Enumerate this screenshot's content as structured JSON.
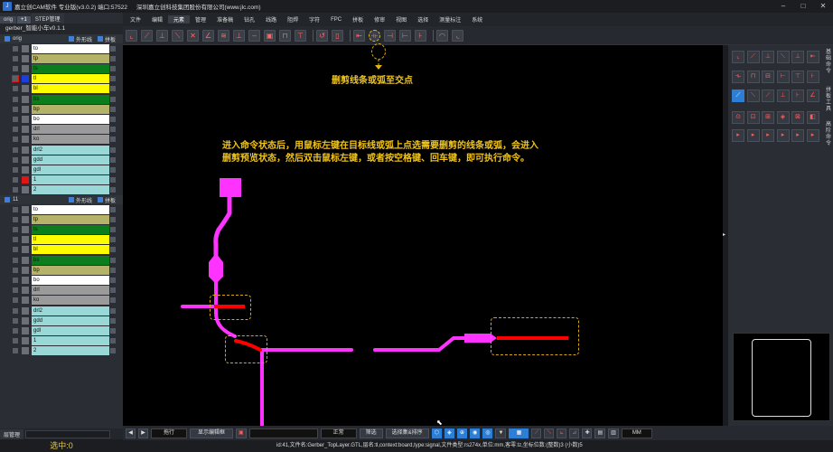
{
  "title": {
    "app": "嘉立创CAM软件 专业版(v3.0.2) 端口:57522",
    "company": "深圳嘉立创科技集团股份有限公司(www.jlc.com)"
  },
  "menu": [
    "文件",
    "编辑",
    "元素",
    "管理",
    "准备稿",
    "钻孔",
    "线路",
    "阻焊",
    "字符",
    "FPC",
    "拼板",
    "修审",
    "视图",
    "选择",
    "测量标注",
    "系统"
  ],
  "left": {
    "tabs": [
      "orig",
      "+1",
      "STEP管理"
    ],
    "root": "gerber_智能小车v0.1.1",
    "group1": {
      "name": "orig",
      "opt1": "外形线",
      "opt2": "拼板"
    },
    "group2": {
      "name": "11",
      "opt1": "外形线",
      "opt2": "拼板"
    },
    "layers1": [
      {
        "name": "to",
        "color": "#ffffff",
        "sq": "#6a6f78"
      },
      {
        "name": "tp",
        "color": "#b5b26a",
        "sq": "#6a6f78"
      },
      {
        "name": "ts",
        "color": "#0b7d1c",
        "sq": "#6a6f78"
      },
      {
        "name": "tl",
        "color": "#fdfd00",
        "sq": "#1a3fe0"
      },
      {
        "name": "bl",
        "color": "#fdfd00",
        "sq": "#6a6f78"
      },
      {
        "name": "bs",
        "color": "#0b7d1c",
        "sq": "#6a6f78"
      },
      {
        "name": "bp",
        "color": "#b5b26a",
        "sq": "#6a6f78"
      },
      {
        "name": "bo",
        "color": "#ffffff",
        "sq": "#6a6f78"
      },
      {
        "name": "drl",
        "color": "#9a9a9a",
        "sq": "#6a6f78"
      },
      {
        "name": "ko",
        "color": "#9a9a9a",
        "sq": "#6a6f78"
      },
      {
        "name": "drl2",
        "color": "#9ad8d8",
        "sq": "#6a6f78"
      },
      {
        "name": "gdd",
        "color": "#9ad8d8",
        "sq": "#6a6f78"
      },
      {
        "name": "gdl",
        "color": "#9ad8d8",
        "sq": "#6a6f78"
      },
      {
        "name": "1",
        "color": "#9ad8d8",
        "sq": "#e01515"
      },
      {
        "name": "2",
        "color": "#9ad8d8",
        "sq": "#6a6f78"
      }
    ],
    "layers2": [
      {
        "name": "to",
        "color": "#ffffff",
        "sq": "#6a6f78"
      },
      {
        "name": "tp",
        "color": "#b5b26a",
        "sq": "#6a6f78"
      },
      {
        "name": "ts",
        "color": "#0b7d1c",
        "sq": "#6a6f78"
      },
      {
        "name": "tl",
        "color": "#fdfd00",
        "sq": "#6a6f78"
      },
      {
        "name": "bl",
        "color": "#fdfd00",
        "sq": "#6a6f78"
      },
      {
        "name": "bs",
        "color": "#0b7d1c",
        "sq": "#6a6f78"
      },
      {
        "name": "bp",
        "color": "#b5b26a",
        "sq": "#6a6f78"
      },
      {
        "name": "bo",
        "color": "#ffffff",
        "sq": "#6a6f78"
      },
      {
        "name": "drl",
        "color": "#9a9a9a",
        "sq": "#6a6f78"
      },
      {
        "name": "ko",
        "color": "#9a9a9a",
        "sq": "#6a6f78"
      },
      {
        "name": "drl2",
        "color": "#9ad8d8",
        "sq": "#6a6f78"
      },
      {
        "name": "gdd",
        "color": "#9ad8d8",
        "sq": "#6a6f78"
      },
      {
        "name": "gdl",
        "color": "#9ad8d8",
        "sq": "#6a6f78"
      },
      {
        "name": "1",
        "color": "#9ad8d8",
        "sq": "#6a6f78"
      },
      {
        "name": "2",
        "color": "#9ad8d8",
        "sq": "#6a6f78"
      }
    ],
    "bottom_tab": "层管理",
    "selected": "选中:0"
  },
  "canvas": {
    "hint1": "删剪线条或弧至交点",
    "hint2a": "进入命令状态后，用鼠标左键在目标线或弧上点选需要删剪的线条或弧，会进入",
    "hint2b": "删剪预览状态，然后双击鼠标左键，或者按空格键、回车键，即可执行命令。",
    "trace_color": "#ff33ff",
    "sel_color": "#ff0000"
  },
  "bottom": {
    "mode": "拖行",
    "btn1": "显示编辑框",
    "mode2": "正常",
    "btn2": "筛选",
    "btn3": "选择集&排序",
    "units": "MM"
  },
  "status": "id:41,文件名:Gerber_TopLayer.GTL,层名:tl,context:board,type:signal,文件类型:rs274x,单位:mm,客零:lz,坐标位数:(整数)3 (小数)5",
  "right_side_labels": [
    "基础命令",
    "拼板工具",
    "高阶命令"
  ]
}
